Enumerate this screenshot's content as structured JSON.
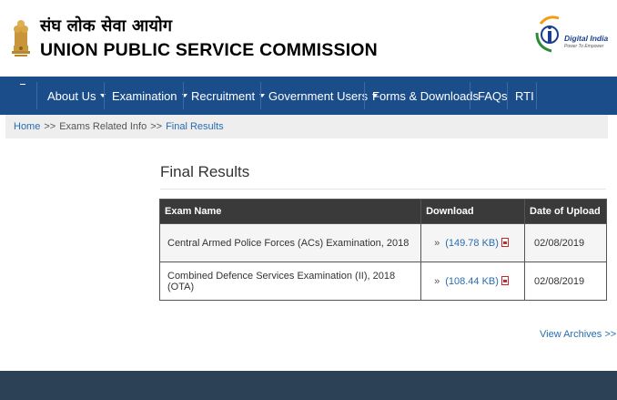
{
  "header": {
    "title_hindi": "संघ लोक सेवा आयोग",
    "title_english": "UNION PUBLIC SERVICE COMMISSION",
    "digital_india": {
      "name": "Digital India",
      "tagline": "Power To Empower"
    }
  },
  "nav": {
    "items": [
      {
        "label": "About Us",
        "dropdown": true
      },
      {
        "label": "Examination",
        "dropdown": true
      },
      {
        "label": "Recruitment",
        "dropdown": true
      },
      {
        "label": "Government Users",
        "dropdown": true
      },
      {
        "label": "Forms & Downloads",
        "dropdown": false
      },
      {
        "label": "FAQs",
        "dropdown": false
      },
      {
        "label": "RTI",
        "dropdown": false
      }
    ]
  },
  "breadcrumb": {
    "items": [
      "Home",
      "Exams Related Info",
      "Final Results"
    ],
    "separator": ">>"
  },
  "main": {
    "title": "Final Results",
    "table": {
      "headers": [
        "Exam Name",
        "Download",
        "Date of Upload"
      ],
      "rows": [
        {
          "exam": "Central Armed Police Forces (ACs) Examination, 2018",
          "raquo": "»",
          "size": "(149.78 KB)",
          "date": "02/08/2019"
        },
        {
          "exam": "Combined Defence Services Examination (II), 2018 (OTA)",
          "raquo": "»",
          "size": "(108.44 KB)",
          "date": "02/08/2019"
        }
      ]
    },
    "archives_link": "View Archives >>"
  },
  "colors": {
    "nav_bg": "#1b4d8a",
    "table_header_bg": "#3a3a3a",
    "link": "#2a6cb0",
    "footer_bg": "#2c4056",
    "pdf_icon": "#c62828"
  },
  "icons": {
    "emblem": "national-emblem-icon",
    "digital_india": "digital-india-logo",
    "download": "pdf-icon"
  }
}
